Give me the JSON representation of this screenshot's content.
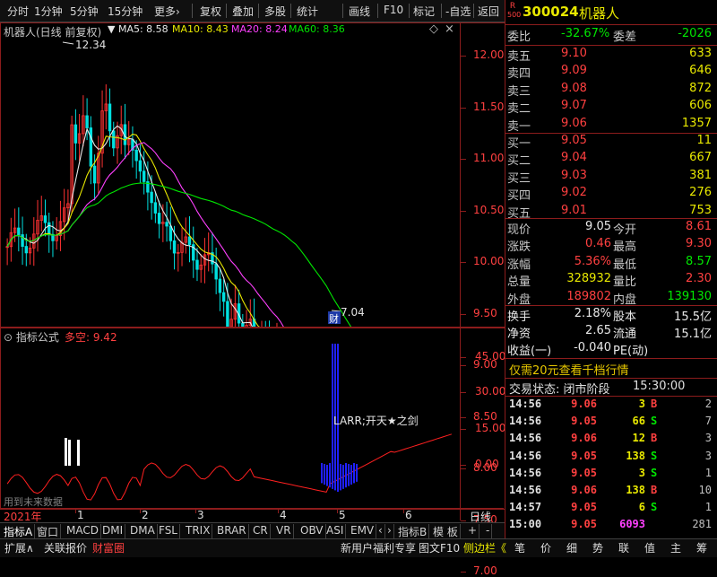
{
  "toolbar": {
    "items": [
      "分时",
      "1分钟",
      "5分钟",
      "15分钟",
      "更多›",
      "复权",
      "叠加",
      "多股",
      "统计",
      "画线",
      "F10",
      "标记",
      "-自选",
      "返回"
    ]
  },
  "stock": {
    "badge_r": "R",
    "badge_num": "500",
    "code": "300024",
    "name": "机器人"
  },
  "main_chart": {
    "title": "机器人(日线 前复权)",
    "ma5_label": "MA5: 8.58",
    "ma10_label": "MA10: 8.43",
    "ma20_label": "MA20: 8.24",
    "ma60_label": "MA60: 8.36",
    "high_label": "12.34",
    "low_label": "7.04",
    "cai_label": "财",
    "price_axis": [
      "12.00",
      "11.50",
      "11.00",
      "10.50",
      "10.00",
      "9.50",
      "9.00",
      "8.50",
      "8.00",
      "7.50",
      "7.00"
    ]
  },
  "colors": {
    "up": "#ff3232",
    "down": "#00e0e0",
    "ma5": "#e8e8e8",
    "ma10": "#e8e800",
    "ma20": "#ff40ff",
    "ma60": "#00e600",
    "indicator": "#ff2020",
    "bars": "#2020ff",
    "frame": "#8c1c1c"
  },
  "indicator": {
    "title": "指标公式",
    "value_label": "多空: 9.42",
    "annotation": "LARR;开天★之剑",
    "future_note": "用到未来数据",
    "axis": [
      "45.00",
      "30.00",
      "15.00",
      "0.00"
    ]
  },
  "time_axis": {
    "year": "2021年",
    "months": [
      "1",
      "2",
      "3",
      "4",
      "5",
      "6"
    ],
    "period": "日线"
  },
  "quote": {
    "weibi_label": "委比",
    "weibi_value": "-32.67%",
    "weicha_label": "委差",
    "weicha_value": "-2026",
    "asks": [
      {
        "label": "卖五",
        "price": "9.10",
        "vol": "633"
      },
      {
        "label": "卖四",
        "price": "9.09",
        "vol": "646"
      },
      {
        "label": "卖三",
        "price": "9.08",
        "vol": "872"
      },
      {
        "label": "卖二",
        "price": "9.07",
        "vol": "606"
      },
      {
        "label": "卖一",
        "price": "9.06",
        "vol": "1357"
      }
    ],
    "bids": [
      {
        "label": "买一",
        "price": "9.05",
        "vol": "11"
      },
      {
        "label": "买二",
        "price": "9.04",
        "vol": "667"
      },
      {
        "label": "买三",
        "price": "9.03",
        "vol": "381"
      },
      {
        "label": "买四",
        "price": "9.02",
        "vol": "276"
      },
      {
        "label": "买五",
        "price": "9.01",
        "vol": "753"
      }
    ],
    "stats": [
      {
        "l1": "现价",
        "v1": "9.05",
        "l2": "今开",
        "v2": "8.61"
      },
      {
        "l1": "涨跌",
        "v1": "0.46",
        "l2": "最高",
        "v2": "9.30"
      },
      {
        "l1": "涨幅",
        "v1": "5.36%",
        "l2": "最低",
        "v2": "8.57"
      },
      {
        "l1": "总量",
        "v1": "328932",
        "l2": "量比",
        "v2": "2.30"
      },
      {
        "l1": "外盘",
        "v1": "189802",
        "l2": "内盘",
        "v2": "139130"
      }
    ],
    "fund": [
      {
        "l1": "换手",
        "v1": "2.18%",
        "l2": "股本",
        "v2": "15.5亿"
      },
      {
        "l1": "净资",
        "v1": "2.65",
        "l2": "流通",
        "v2": "15.1亿"
      },
      {
        "l1": "收益(一)",
        "v1": "-0.040",
        "l2": "PE(动)",
        "v2": ""
      }
    ],
    "promo": "仅需20元查看千档行情",
    "trade_status_label": "交易状态: 闭市阶段",
    "trade_status_time": "15:30:00"
  },
  "ticks": [
    {
      "time": "14:56",
      "price": "9.06",
      "vol": "3",
      "bs": "B",
      "n": "2"
    },
    {
      "time": "14:56",
      "price": "9.05",
      "vol": "66",
      "bs": "S",
      "n": "7"
    },
    {
      "time": "14:56",
      "price": "9.06",
      "vol": "12",
      "bs": "B",
      "n": "3"
    },
    {
      "time": "14:56",
      "price": "9.05",
      "vol": "138",
      "bs": "S",
      "n": "3"
    },
    {
      "time": "14:56",
      "price": "9.05",
      "vol": "3",
      "bs": "S",
      "n": "1"
    },
    {
      "time": "14:56",
      "price": "9.06",
      "vol": "138",
      "bs": "B",
      "n": "10"
    },
    {
      "time": "14:57",
      "price": "9.05",
      "vol": "6",
      "bs": "S",
      "n": "1"
    },
    {
      "time": "15:00",
      "price": "9.05",
      "vol": "6093",
      "bs": "",
      "n": "281"
    }
  ],
  "bottom_tabs": [
    "指标A",
    "窗口",
    "MACD",
    "DMI",
    "DMA",
    "FSL",
    "TRIX",
    "BRAR",
    "CR",
    "VR",
    "OBV",
    "ASI",
    "EMV",
    "‹",
    "›",
    "指标B",
    "模 板",
    "+",
    "-"
  ],
  "footer": {
    "left": [
      "扩展∧",
      "关联报价",
      "财富圈"
    ],
    "mid": [
      "新用户福利专享",
      "图文F10",
      "侧边栏《"
    ],
    "right": [
      "笔",
      "价",
      "细",
      "势",
      "联",
      "值",
      "主",
      "筹"
    ]
  }
}
